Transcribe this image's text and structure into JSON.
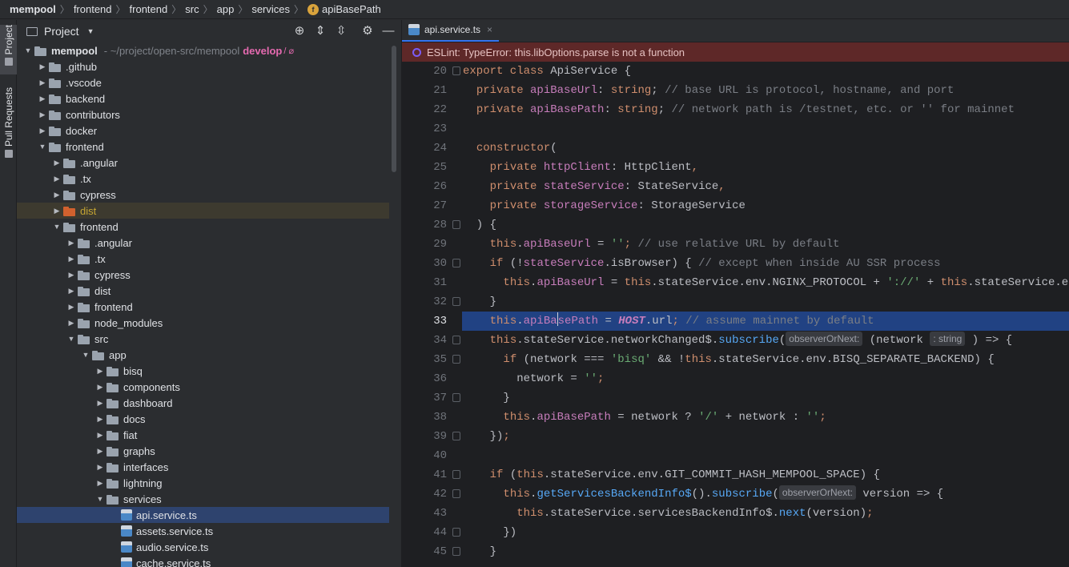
{
  "breadcrumb": {
    "items": [
      "mempool",
      "frontend",
      "frontend",
      "src",
      "app",
      "services"
    ],
    "file_icon_letter": "f",
    "file": "apiBasePath"
  },
  "tool_strip": {
    "project_label": "Project",
    "pull_requests_label": "Pull Requests"
  },
  "project_panel": {
    "title": "Project",
    "tree": [
      {
        "label": "mempool",
        "depth": 0,
        "open": true,
        "icon": "folder",
        "note": "~/project/open-src/mempool",
        "branch": "develop",
        "branch_symbol": "/ ⌀",
        "root": true
      },
      {
        "label": ".github",
        "depth": 1,
        "open": false,
        "icon": "folder"
      },
      {
        "label": ".vscode",
        "depth": 1,
        "open": false,
        "icon": "folder"
      },
      {
        "label": "backend",
        "depth": 1,
        "open": false,
        "icon": "folder"
      },
      {
        "label": "contributors",
        "depth": 1,
        "open": false,
        "icon": "folder"
      },
      {
        "label": "docker",
        "depth": 1,
        "open": false,
        "icon": "folder"
      },
      {
        "label": "frontend",
        "depth": 1,
        "open": true,
        "icon": "folder"
      },
      {
        "label": ".angular",
        "depth": 2,
        "open": false,
        "icon": "folder"
      },
      {
        "label": ".tx",
        "depth": 2,
        "open": false,
        "icon": "folder"
      },
      {
        "label": "cypress",
        "depth": 2,
        "open": false,
        "icon": "folder"
      },
      {
        "label": "dist",
        "depth": 2,
        "open": false,
        "icon": "folder-orange",
        "state": "dist"
      },
      {
        "label": "frontend",
        "depth": 2,
        "open": true,
        "icon": "folder-module"
      },
      {
        "label": ".angular",
        "depth": 3,
        "open": false,
        "icon": "folder"
      },
      {
        "label": ".tx",
        "depth": 3,
        "open": false,
        "icon": "folder"
      },
      {
        "label": "cypress",
        "depth": 3,
        "open": false,
        "icon": "folder"
      },
      {
        "label": "dist",
        "depth": 3,
        "open": false,
        "icon": "folder"
      },
      {
        "label": "frontend",
        "depth": 3,
        "open": false,
        "icon": "folder-module"
      },
      {
        "label": "node_modules",
        "depth": 3,
        "open": false,
        "icon": "folder"
      },
      {
        "label": "src",
        "depth": 3,
        "open": true,
        "icon": "folder"
      },
      {
        "label": "app",
        "depth": 4,
        "open": true,
        "icon": "folder"
      },
      {
        "label": "bisq",
        "depth": 5,
        "open": false,
        "icon": "folder"
      },
      {
        "label": "components",
        "depth": 5,
        "open": false,
        "icon": "folder"
      },
      {
        "label": "dashboard",
        "depth": 5,
        "open": false,
        "icon": "folder"
      },
      {
        "label": "docs",
        "depth": 5,
        "open": false,
        "icon": "folder"
      },
      {
        "label": "fiat",
        "depth": 5,
        "open": false,
        "icon": "folder"
      },
      {
        "label": "graphs",
        "depth": 5,
        "open": false,
        "icon": "folder"
      },
      {
        "label": "interfaces",
        "depth": 5,
        "open": false,
        "icon": "folder"
      },
      {
        "label": "lightning",
        "depth": 5,
        "open": false,
        "icon": "folder"
      },
      {
        "label": "services",
        "depth": 5,
        "open": true,
        "icon": "folder"
      },
      {
        "label": "api.service.ts",
        "depth": 6,
        "icon": "ts",
        "state": "selected"
      },
      {
        "label": "assets.service.ts",
        "depth": 6,
        "icon": "ts"
      },
      {
        "label": "audio.service.ts",
        "depth": 6,
        "icon": "ts"
      },
      {
        "label": "cache.service.ts",
        "depth": 6,
        "icon": "ts"
      }
    ]
  },
  "editor": {
    "tab_label": "api.service.ts",
    "tab_close": "×",
    "lint_message": "ESLint: TypeError: this.libOptions.parse is not a function",
    "current_line": 33,
    "lines": [
      {
        "n": 20,
        "fold": "open",
        "segs": [
          [
            "kw",
            "export class "
          ],
          [
            "",
            "ApiService {"
          ]
        ]
      },
      {
        "n": 21,
        "segs": [
          [
            "",
            "  "
          ],
          [
            "kw",
            "private "
          ],
          [
            "prop",
            "apiBaseUrl"
          ],
          [
            "",
            ": "
          ],
          [
            "kw",
            "string"
          ],
          [
            "",
            ";"
          ],
          [
            "cm",
            " // base URL is protocol, hostname, and port"
          ]
        ]
      },
      {
        "n": 22,
        "segs": [
          [
            "",
            "  "
          ],
          [
            "kw",
            "private "
          ],
          [
            "prop",
            "apiBasePath"
          ],
          [
            "",
            ": "
          ],
          [
            "kw",
            "string"
          ],
          [
            "",
            ";"
          ],
          [
            "cm",
            " // network path is /testnet, etc. or '' for mainnet"
          ]
        ]
      },
      {
        "n": 23,
        "segs": [
          [
            "",
            ""
          ]
        ]
      },
      {
        "n": 24,
        "segs": [
          [
            "",
            "  "
          ],
          [
            "kw",
            "constructor"
          ],
          [
            "",
            "("
          ]
        ]
      },
      {
        "n": 25,
        "segs": [
          [
            "",
            "    "
          ],
          [
            "kw",
            "private "
          ],
          [
            "prop",
            "httpClient"
          ],
          [
            "",
            ": HttpClient"
          ],
          [
            "kw",
            ","
          ]
        ]
      },
      {
        "n": 26,
        "segs": [
          [
            "",
            "    "
          ],
          [
            "kw",
            "private "
          ],
          [
            "prop",
            "stateService"
          ],
          [
            "",
            ": StateService"
          ],
          [
            "kw",
            ","
          ]
        ]
      },
      {
        "n": 27,
        "segs": [
          [
            "",
            "    "
          ],
          [
            "kw",
            "private "
          ],
          [
            "prop",
            "storageService"
          ],
          [
            "",
            ": StorageService"
          ]
        ]
      },
      {
        "n": 28,
        "fold": "box",
        "segs": [
          [
            "",
            "  ) {"
          ]
        ]
      },
      {
        "n": 29,
        "segs": [
          [
            "",
            "    "
          ],
          [
            "kw",
            "this"
          ],
          [
            "",
            "."
          ],
          [
            "prop",
            "apiBaseUrl"
          ],
          [
            "",
            " = "
          ],
          [
            "str",
            "''"
          ],
          [
            "kw",
            ";"
          ],
          [
            "cm",
            " // use relative URL by default"
          ]
        ]
      },
      {
        "n": 30,
        "fold": "box",
        "segs": [
          [
            "",
            "    "
          ],
          [
            "kw",
            "if "
          ],
          [
            "",
            "(!"
          ],
          [
            "prop",
            "stateService"
          ],
          [
            "",
            ".isBrowser) { "
          ],
          [
            "cm",
            "// except when inside AU SSR process"
          ]
        ]
      },
      {
        "n": 31,
        "segs": [
          [
            "",
            "      "
          ],
          [
            "kw",
            "this"
          ],
          [
            "",
            "."
          ],
          [
            "prop",
            "apiBaseUrl"
          ],
          [
            "",
            " = "
          ],
          [
            "kw",
            "this"
          ],
          [
            "",
            ".stateService.env.NGINX_PROTOCOL + "
          ],
          [
            "str",
            "'://'"
          ],
          [
            "",
            " + "
          ],
          [
            "kw",
            "this"
          ],
          [
            "",
            ".stateService.en"
          ]
        ]
      },
      {
        "n": 32,
        "fold": "box",
        "segs": [
          [
            "",
            "    }"
          ]
        ]
      },
      {
        "n": 33,
        "segs": [
          [
            "",
            "    "
          ],
          [
            "kw",
            "this"
          ],
          [
            "",
            "."
          ],
          [
            "prop",
            "apiBa"
          ],
          [
            "caret",
            ""
          ],
          [
            "prop",
            "sePath"
          ],
          [
            "",
            " = "
          ],
          [
            "const",
            "HOST"
          ],
          [
            "",
            ".url"
          ],
          [
            "kw",
            ";"
          ],
          [
            "cm",
            " // assume mainnet by default"
          ]
        ]
      },
      {
        "n": 34,
        "fold": "box",
        "segs": [
          [
            "",
            "    "
          ],
          [
            "kw",
            "this"
          ],
          [
            "",
            ".stateService.networkChanged$."
          ],
          [
            "fn",
            "subscribe"
          ],
          [
            "",
            "("
          ],
          [
            "hint",
            "observerOrNext:"
          ],
          [
            "",
            " (network "
          ],
          [
            "hint",
            ": string"
          ],
          [
            "",
            " ) => {"
          ]
        ]
      },
      {
        "n": 35,
        "fold": "box",
        "segs": [
          [
            "",
            "      "
          ],
          [
            "kw",
            "if "
          ],
          [
            "",
            "(network === "
          ],
          [
            "str",
            "'bisq'"
          ],
          [
            "",
            " && !"
          ],
          [
            "kw",
            "this"
          ],
          [
            "",
            ".stateService.env.BISQ_SEPARATE_BACKEND) {"
          ]
        ]
      },
      {
        "n": 36,
        "segs": [
          [
            "",
            "        network = "
          ],
          [
            "str",
            "''"
          ],
          [
            "kw",
            ";"
          ]
        ]
      },
      {
        "n": 37,
        "fold": "box",
        "segs": [
          [
            "",
            "      }"
          ]
        ]
      },
      {
        "n": 38,
        "segs": [
          [
            "",
            "      "
          ],
          [
            "kw",
            "this"
          ],
          [
            "",
            "."
          ],
          [
            "prop",
            "apiBasePath"
          ],
          [
            "",
            " = network ? "
          ],
          [
            "str",
            "'/'"
          ],
          [
            "",
            " + network : "
          ],
          [
            "str",
            "''"
          ],
          [
            "kw",
            ";"
          ]
        ]
      },
      {
        "n": 39,
        "fold": "box",
        "segs": [
          [
            "",
            "    })"
          ],
          [
            "kw",
            ";"
          ]
        ]
      },
      {
        "n": 40,
        "segs": [
          [
            "",
            ""
          ]
        ]
      },
      {
        "n": 41,
        "fold": "box",
        "segs": [
          [
            "",
            "    "
          ],
          [
            "kw",
            "if "
          ],
          [
            "",
            "("
          ],
          [
            "kw",
            "this"
          ],
          [
            "",
            ".stateService.env.GIT_COMMIT_HASH_MEMPOOL_SPACE) {"
          ]
        ]
      },
      {
        "n": 42,
        "fold": "box",
        "segs": [
          [
            "",
            "      "
          ],
          [
            "kw",
            "this"
          ],
          [
            "",
            "."
          ],
          [
            "fn",
            "getServicesBackendInfo$"
          ],
          [
            "",
            "()."
          ],
          [
            "fn",
            "subscribe"
          ],
          [
            "",
            "("
          ],
          [
            "hint",
            "observerOrNext:"
          ],
          [
            "",
            " version => {"
          ]
        ]
      },
      {
        "n": 43,
        "segs": [
          [
            "",
            "        "
          ],
          [
            "kw",
            "this"
          ],
          [
            "",
            ".stateService.servicesBackendInfo$."
          ],
          [
            "fn",
            "next"
          ],
          [
            "",
            "(version)"
          ],
          [
            "kw",
            ";"
          ]
        ]
      },
      {
        "n": 44,
        "fold": "box",
        "segs": [
          [
            "",
            "      })"
          ]
        ]
      },
      {
        "n": 45,
        "fold": "box",
        "segs": [
          [
            "",
            "    }"
          ]
        ]
      }
    ]
  }
}
